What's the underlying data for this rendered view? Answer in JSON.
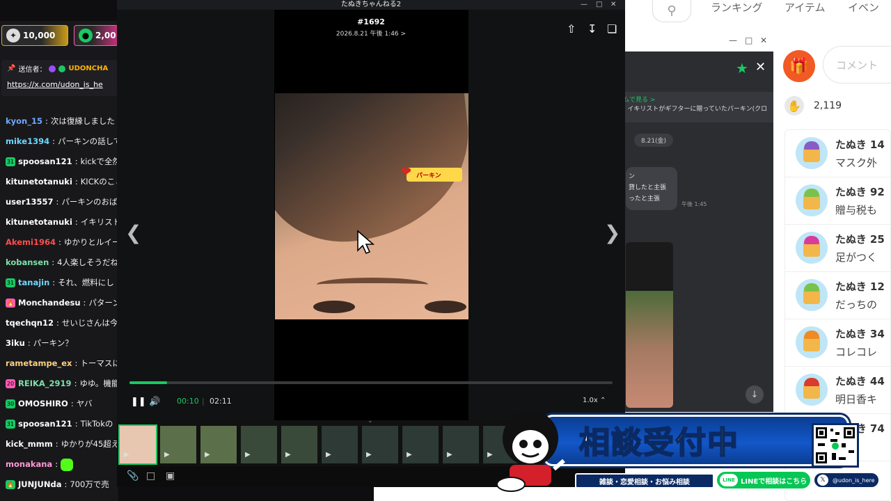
{
  "chat": {
    "coins": [
      {
        "value": "10,000",
        "icon": "star-coin-icon"
      },
      {
        "value": "2,00",
        "icon": "kick-coin-icon"
      }
    ],
    "pinned": {
      "sender_label": "送信者：",
      "sender_name": "UDONCHA",
      "link": "https://x.com/udon_is_he"
    },
    "messages": [
      {
        "user": "kyon_15",
        "text": "次は復縁しました",
        "color": "#6fa8ff",
        "badge": ""
      },
      {
        "user": "mike1394",
        "text": "パーキンの話して",
        "color": "#6fd8ff",
        "badge": ""
      },
      {
        "user": "spoosan121",
        "text": "kickで全然",
        "color": "#ffffff",
        "badge": "31",
        "badge_color": "#18c964"
      },
      {
        "user": "kitunetotanuki",
        "text": "KICKのこと",
        "color": "#ffffff",
        "badge": ""
      },
      {
        "user": "user13557",
        "text": "パーキンのおば",
        "color": "#ffffff",
        "badge": ""
      },
      {
        "user": "kitunetotanuki",
        "text": "イキリスト",
        "color": "#ffffff",
        "badge": ""
      },
      {
        "user": "Akemi1964",
        "text": "ゆかりとルイー",
        "color": "#ff4d4d",
        "badge": ""
      },
      {
        "user": "kobansen",
        "text": "4人楽しそうだね",
        "color": "#7ee0a8",
        "badge": ""
      },
      {
        "user": "tanajin",
        "text": "それ、燃料にし",
        "color": "#6fd8ff",
        "badge": "31",
        "badge_color": "#18c964"
      },
      {
        "user": "Monchandesu",
        "text": "パターン",
        "color": "#ffffff",
        "badge": "🔥",
        "badge_color": "#ff5cb0"
      },
      {
        "user": "tqechqn12",
        "text": "せいじさんは今",
        "color": "#ffffff",
        "badge": ""
      },
      {
        "user": "3iku",
        "text": "パーキン？",
        "color": "#ffffff",
        "badge": ""
      },
      {
        "user": "rametampe_ex",
        "text": "トーマスに",
        "color": "#ffd080",
        "badge": ""
      },
      {
        "user": "REIKA_2919",
        "text": "ゆゆ。機能",
        "color": "#7ee0a8",
        "badge": "20",
        "badge_color": "#ff5cb0"
      },
      {
        "user": "OMOSHIRO",
        "text": "ヤバ",
        "color": "#ffffff",
        "badge": "30",
        "badge_color": "#18c964"
      },
      {
        "user": "spoosan121",
        "text": "TikTokの",
        "color": "#ffffff",
        "badge": "31",
        "badge_color": "#18c964"
      },
      {
        "user": "kick_mmm",
        "text": "ゆかりが45超え",
        "color": "#ffffff",
        "badge": ""
      },
      {
        "user": "monakana",
        "text": "",
        "color": "#ff9ad5",
        "badge": ""
      },
      {
        "user": "JUNJUNda",
        "text": "700万で売",
        "color": "#ffffff",
        "badge": "🔥",
        "badge_color": "#18c964"
      }
    ]
  },
  "web": {
    "nav": [
      "ランキング",
      "アイテム",
      "イベン"
    ],
    "comment_placeholder": "コメント",
    "clap_count": "2,119",
    "comments": [
      {
        "name": "たぬき 14",
        "text": "マスク外",
        "hat": "#8a5cc5"
      },
      {
        "name": "たぬき 92",
        "text": "贈与税も",
        "hat": "#7bc24a"
      },
      {
        "name": "たぬき 25",
        "text": "足がつく",
        "hat": "#d93b9b"
      },
      {
        "name": "たぬき 12",
        "text": "だっちの",
        "hat": "#7bc24a"
      },
      {
        "name": "たぬき 34",
        "text": "コレコレ",
        "hat": "#f08a24"
      },
      {
        "name": "たぬき 44",
        "text": "明日香キ",
        "hat": "#d93b2e"
      },
      {
        "name": "たぬき 74",
        "text": "",
        "hat": "#8a5cc5"
      }
    ]
  },
  "line": {
    "banner_line1": "ムで見る >",
    "banner_line2": "] イキリストがギフターに贈っていたパーキン(クロ",
    "date": "8.21(金)",
    "bubble_lines": [
      "ン",
      "貸したと主張",
      "ったと主張"
    ],
    "time": "午後 1:45"
  },
  "viewer": {
    "window_title": "たぬきちゃんねる2",
    "item_number": "#1692",
    "item_date": "2026.8.21 午後 1:46 >",
    "sticker_text": "パーキン",
    "current_time": "00:10",
    "total_time": "02:11",
    "speed": "1.0x",
    "progress": 0.078
  },
  "overlay": {
    "title_part1": "相談",
    "title_part2": "受付中",
    "subtitle": "雑談・恋愛相談・お悩み相談",
    "line_text": "LINEで相談はこちら",
    "line_badge": "LINE",
    "x_handle": "@udon_is_here"
  }
}
